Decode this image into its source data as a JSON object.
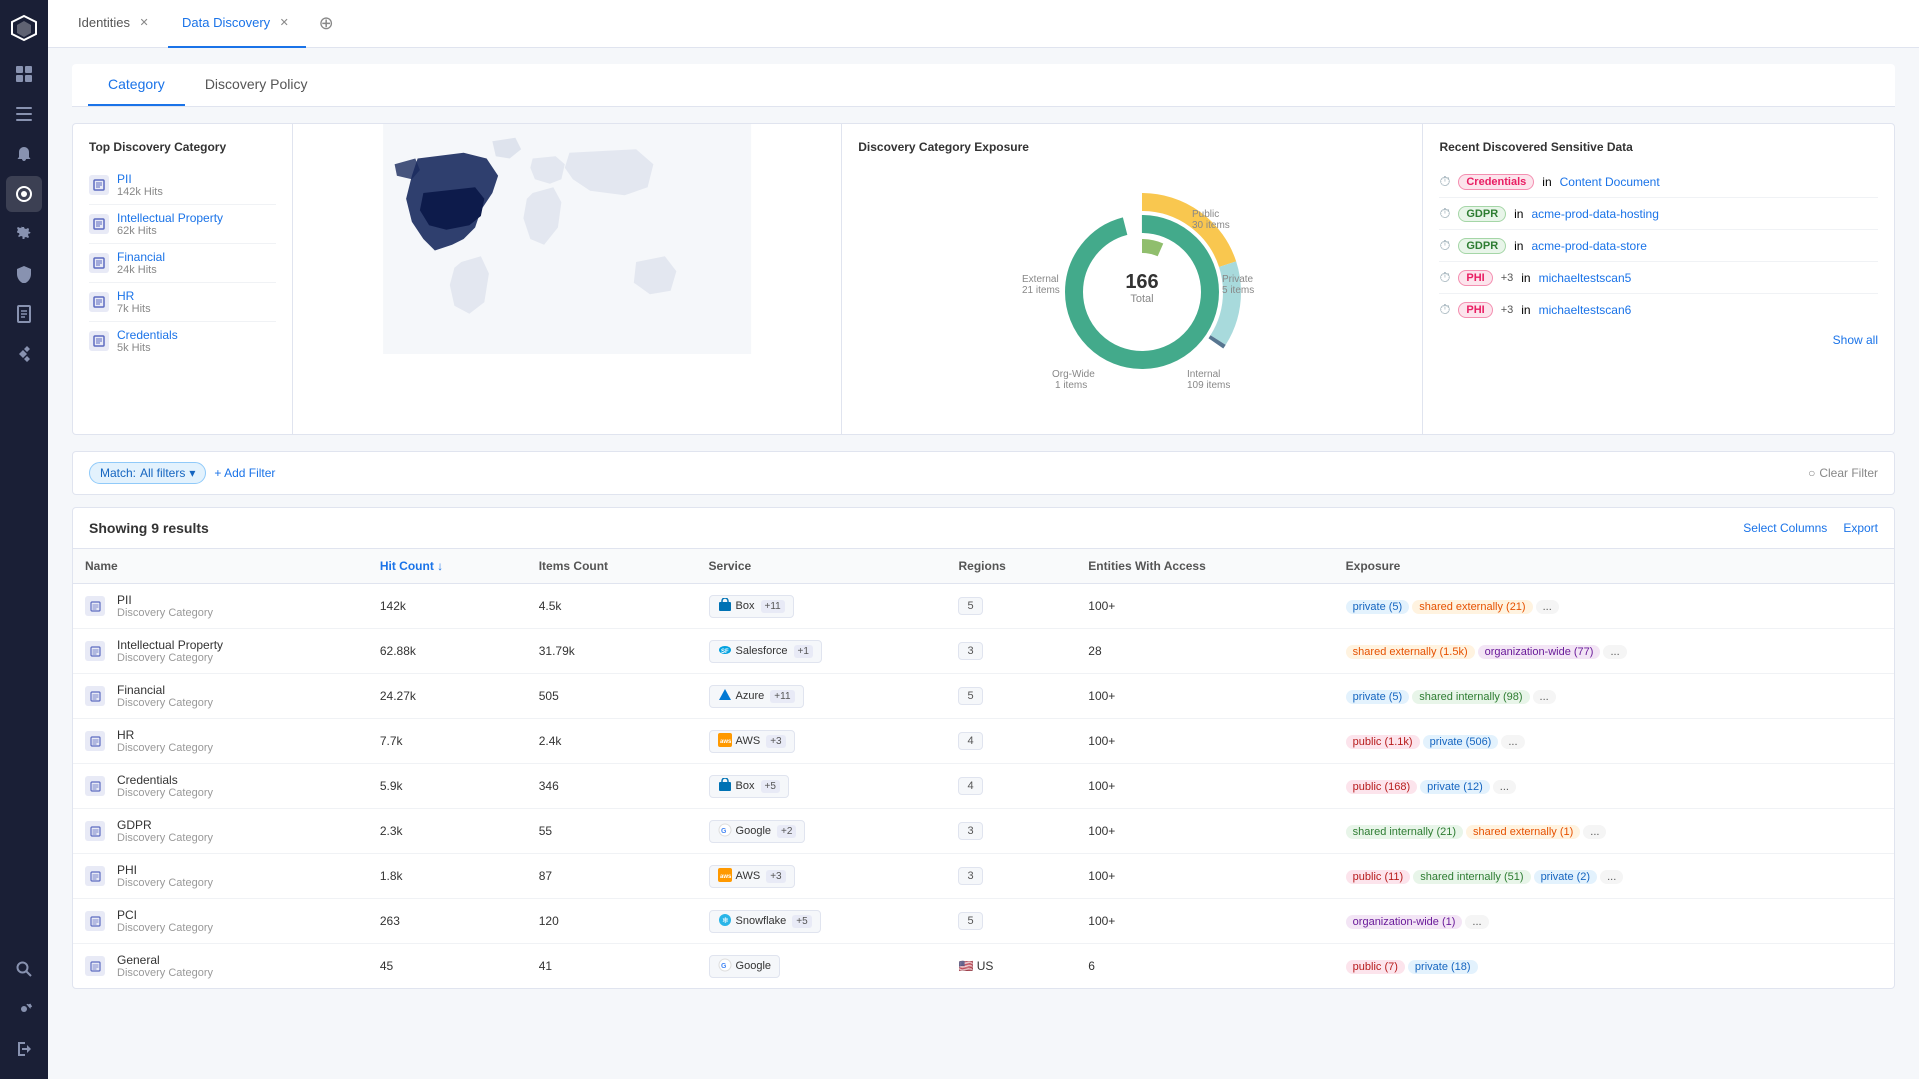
{
  "app": {
    "title": "Data Discovery"
  },
  "tabs": [
    {
      "id": "identities",
      "label": "Identities",
      "active": false,
      "closable": true
    },
    {
      "id": "data-discovery",
      "label": "Data Discovery",
      "active": true,
      "closable": true
    }
  ],
  "subtabs": [
    {
      "id": "category",
      "label": "Category",
      "active": true
    },
    {
      "id": "discovery-policy",
      "label": "Discovery Policy",
      "active": false
    }
  ],
  "top_category": {
    "title": "Top Discovery Category",
    "items": [
      {
        "name": "PII",
        "hits": "142k Hits"
      },
      {
        "name": "Intellectual Property",
        "hits": "62k Hits"
      },
      {
        "name": "Financial",
        "hits": "24k Hits"
      },
      {
        "name": "HR",
        "hits": "7k Hits"
      },
      {
        "name": "Credentials",
        "hits": "5k Hits"
      }
    ]
  },
  "donut": {
    "title": "Discovery Category Exposure",
    "total": "166",
    "total_label": "Total",
    "segments": [
      {
        "label": "Public",
        "sublabel": "30 items",
        "color": "#f9c74f",
        "value": 30
      },
      {
        "label": "Private",
        "sublabel": "5 items",
        "color": "#90be6d",
        "value": 5
      },
      {
        "label": "Internal",
        "sublabel": "109 items",
        "color": "#43aa8b",
        "value": 109
      },
      {
        "label": "Org-Wide",
        "sublabel": "1 items",
        "color": "#577590",
        "value": 1
      },
      {
        "label": "External",
        "sublabel": "21 items",
        "color": "#a8dadc",
        "value": 21
      }
    ]
  },
  "recent_sensitive": {
    "title": "Recent Discovered Sensitive Data",
    "items": [
      {
        "badge": "Credentials",
        "badge_type": "pink",
        "text": "in",
        "link": "Content Document"
      },
      {
        "badge": "GDPR",
        "badge_type": "green",
        "text": "in",
        "link": "acme-prod-data-hosting"
      },
      {
        "badge": "GDPR",
        "badge_type": "green",
        "text": "in",
        "link": "acme-prod-data-store"
      },
      {
        "badge": "PHI",
        "badge_type": "pink",
        "extra": "+3",
        "text": "in",
        "link": "michaeltestscan5"
      },
      {
        "badge": "PHI",
        "badge_type": "pink",
        "extra": "+3",
        "text": "in",
        "link": "michaeltestscan6"
      }
    ],
    "show_all": "Show all"
  },
  "filter": {
    "match_label": "Match:",
    "match_value": "All filters",
    "add_label": "+ Add Filter",
    "clear_label": "Clear Filter"
  },
  "results": {
    "count_label": "Showing 9 results",
    "select_columns": "Select Columns",
    "export": "Export",
    "columns": [
      "Name",
      "Hit Count",
      "Items Count",
      "Service",
      "Regions",
      "Entities With Access",
      "Exposure"
    ],
    "rows": [
      {
        "name": "PII",
        "sub": "Discovery Category",
        "hit_count": "142k",
        "items_count": "4.5k",
        "service": "Box",
        "service_icon": "box",
        "service_plus": "+11",
        "regions": "5",
        "entities": "100+",
        "exposure": [
          {
            "label": "private (5)",
            "type": "blue"
          },
          {
            "label": "shared externally (21)",
            "type": "orange"
          },
          {
            "label": "...",
            "type": "gray"
          }
        ]
      },
      {
        "name": "Intellectual Property",
        "sub": "Discovery Category",
        "hit_count": "62.88k",
        "items_count": "31.79k",
        "service": "Salesforce",
        "service_icon": "salesforce",
        "service_plus": "+1",
        "regions": "3",
        "entities": "28",
        "exposure": [
          {
            "label": "shared externally (1.5k)",
            "type": "orange"
          },
          {
            "label": "organization-wide (77)",
            "type": "purple"
          },
          {
            "label": "...",
            "type": "gray"
          }
        ]
      },
      {
        "name": "Financial",
        "sub": "Discovery Category",
        "hit_count": "24.27k",
        "items_count": "505",
        "service": "Azure",
        "service_icon": "azure",
        "service_plus": "+11",
        "regions": "5",
        "entities": "100+",
        "exposure": [
          {
            "label": "private (5)",
            "type": "blue"
          },
          {
            "label": "shared internally (98)",
            "type": "green"
          },
          {
            "label": "...",
            "type": "gray"
          }
        ]
      },
      {
        "name": "HR",
        "sub": "Discovery Category",
        "hit_count": "7.7k",
        "items_count": "2.4k",
        "service": "AWS",
        "service_icon": "aws",
        "service_plus": "+3",
        "regions": "4",
        "entities": "100+",
        "exposure": [
          {
            "label": "public (1.1k)",
            "type": "red"
          },
          {
            "label": "private (506)",
            "type": "blue"
          },
          {
            "label": "...",
            "type": "gray"
          }
        ]
      },
      {
        "name": "Credentials",
        "sub": "Discovery Category",
        "hit_count": "5.9k",
        "items_count": "346",
        "service": "Box",
        "service_icon": "box",
        "service_plus": "+5",
        "regions": "4",
        "entities": "100+",
        "exposure": [
          {
            "label": "public (168)",
            "type": "red"
          },
          {
            "label": "private (12)",
            "type": "blue"
          },
          {
            "label": "...",
            "type": "gray"
          }
        ]
      },
      {
        "name": "GDPR",
        "sub": "Discovery Category",
        "hit_count": "2.3k",
        "items_count": "55",
        "service": "Google",
        "service_icon": "google",
        "service_plus": "+2",
        "regions": "3",
        "entities": "100+",
        "exposure": [
          {
            "label": "shared internally (21)",
            "type": "green"
          },
          {
            "label": "shared externally (1)",
            "type": "orange"
          },
          {
            "label": "...",
            "type": "gray"
          }
        ]
      },
      {
        "name": "PHI",
        "sub": "Discovery Category",
        "hit_count": "1.8k",
        "items_count": "87",
        "service": "AWS",
        "service_icon": "aws",
        "service_plus": "+3",
        "regions": "3",
        "entities": "100+",
        "exposure": [
          {
            "label": "public (11)",
            "type": "red"
          },
          {
            "label": "shared internally (51)",
            "type": "green"
          },
          {
            "label": "private (2)",
            "type": "blue"
          },
          {
            "label": "...",
            "type": "gray"
          }
        ]
      },
      {
        "name": "PCI",
        "sub": "Discovery Category",
        "hit_count": "263",
        "items_count": "120",
        "service": "Snowflake",
        "service_icon": "snowflake",
        "service_plus": "+5",
        "regions": "5",
        "entities": "100+",
        "exposure": [
          {
            "label": "organization-wide (1)",
            "type": "purple"
          },
          {
            "label": "...",
            "type": "gray"
          }
        ]
      },
      {
        "name": "General",
        "sub": "Discovery Category",
        "hit_count": "45",
        "items_count": "41",
        "service": "Google",
        "service_icon": "google",
        "service_plus": "",
        "regions": "US",
        "entities": "6",
        "exposure": [
          {
            "label": "public (7)",
            "type": "red"
          },
          {
            "label": "private (18)",
            "type": "blue"
          }
        ]
      }
    ]
  },
  "sidebar": {
    "items": [
      {
        "id": "logo",
        "icon": "◈"
      },
      {
        "id": "dashboard",
        "icon": "▦"
      },
      {
        "id": "list",
        "icon": "☰"
      },
      {
        "id": "bell",
        "icon": "🔔"
      },
      {
        "id": "network",
        "icon": "⬡"
      },
      {
        "id": "settings-gear",
        "icon": "⚙"
      },
      {
        "id": "data",
        "icon": "◉"
      },
      {
        "id": "shield",
        "icon": "🛡"
      },
      {
        "id": "file",
        "icon": "📄"
      },
      {
        "id": "star",
        "icon": "✦"
      },
      {
        "id": "search",
        "icon": "🔍"
      },
      {
        "id": "gear2",
        "icon": "⚙"
      },
      {
        "id": "logout",
        "icon": "→"
      }
    ]
  }
}
